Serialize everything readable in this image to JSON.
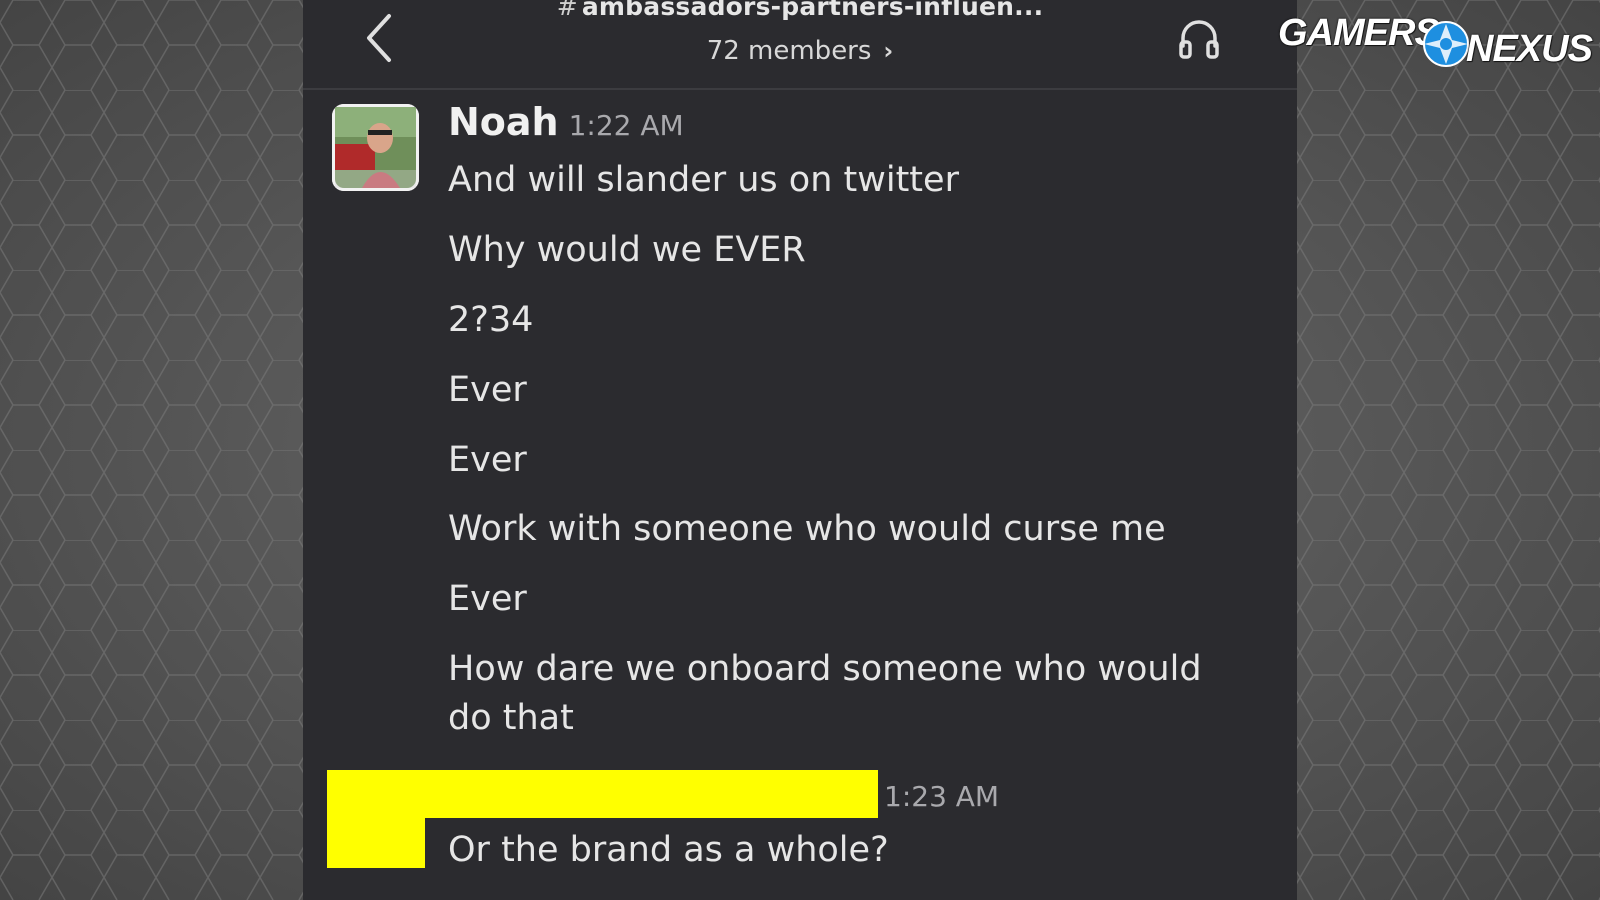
{
  "header": {
    "channel_hash": "#",
    "channel_name": "ambassadors-partners-influen...",
    "members_label": "72 members",
    "back_icon": "chevron-left-icon",
    "audio_icon": "headphones-icon"
  },
  "messages": [
    {
      "author": "Noah",
      "time": "1:22 AM",
      "lines": [
        "And will slander us on twitter",
        "Why would we EVER",
        "2?34",
        "Ever",
        "Ever",
        "Work with someone who would curse me",
        "Ever",
        "How dare we onboard someone who would do that"
      ]
    },
    {
      "author_redacted": true,
      "time": "1:23 AM",
      "lines": [
        "Or the brand as a whole?"
      ]
    }
  ],
  "watermark": {
    "word1": "GAMERS",
    "word2": "NEXUS"
  },
  "colors": {
    "app_bg": "#2b2b2f",
    "text": "#e6e6e6",
    "timestamp": "#a9a9ad",
    "redaction": "#ffff00"
  }
}
